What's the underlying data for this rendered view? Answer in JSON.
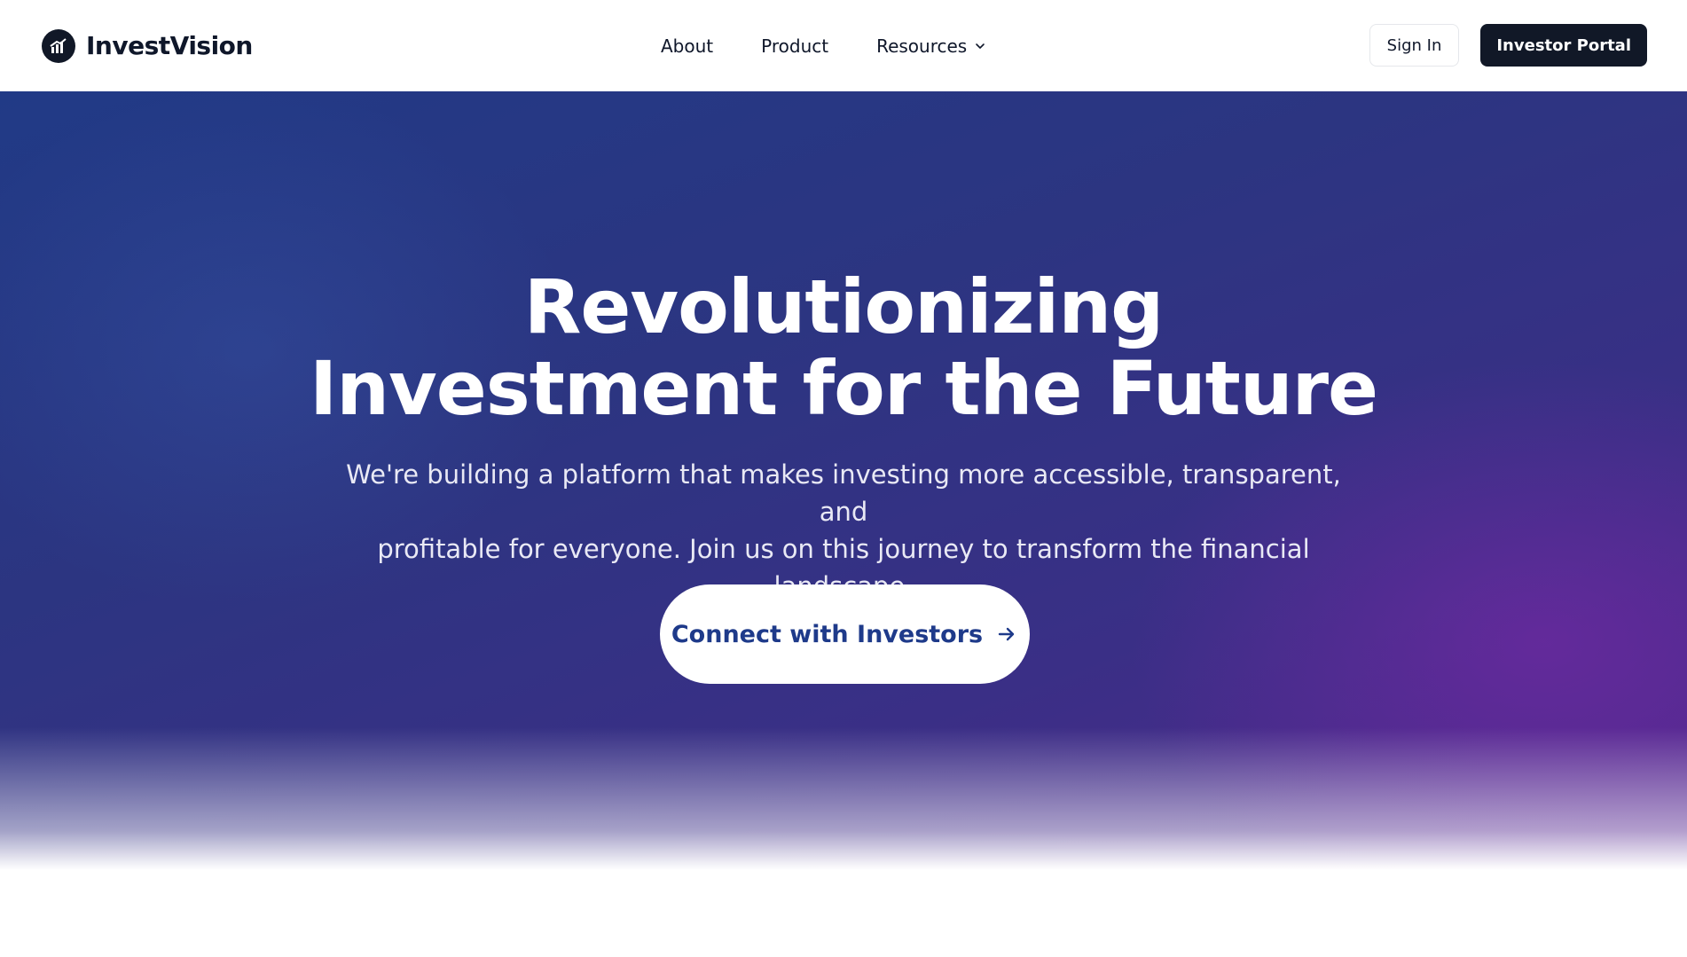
{
  "brand": {
    "name": "InvestVision",
    "logo_icon": "chart-bars-logo-icon"
  },
  "nav": {
    "items": [
      {
        "label": "About"
      },
      {
        "label": "Product"
      },
      {
        "label": "Resources",
        "icon": "chevron-down-icon"
      }
    ]
  },
  "actions": {
    "sign_in_label": "Sign In",
    "portal_label": "Investor Portal"
  },
  "hero": {
    "title_line1": "Revolutionizing",
    "title_line2": "Investment for the Future",
    "subtitle_line1": "We're building a platform that makes investing more accessible, transparent, and",
    "subtitle_line2": "profitable for everyone. Join us on this journey to transform the financial landscape.",
    "cta_label": "Connect with Investors",
    "cta_icon": "arrow-right-icon"
  },
  "colors": {
    "dark": "#111827",
    "hero_start": "#213a86",
    "hero_end": "#57268f",
    "cta_text": "#1e3a8a"
  }
}
